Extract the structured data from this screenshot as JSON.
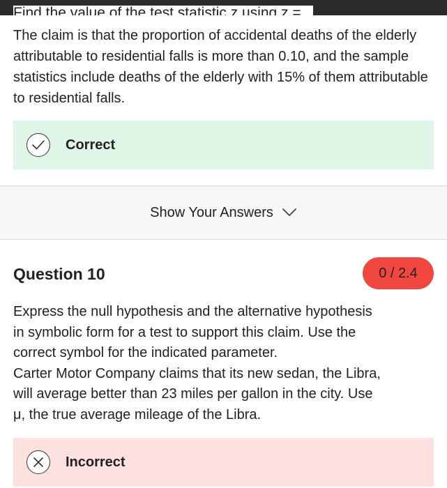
{
  "previous_question": {
    "clipped_line": "Find the value of the test statistic z using z = .",
    "claim_text": "The claim is that the proportion of accidental deaths of the elderly attributable to residential falls is more than 0.10, and the sample statistics include  deaths of the elderly with 15% of them attributable to residential falls.",
    "result": {
      "label": "Correct",
      "icon": "check-icon",
      "color": "#dff5e6"
    }
  },
  "answers_toggle": {
    "label": "Show Your Answers",
    "icon": "chevron-down-icon"
  },
  "question": {
    "title": "Question 10",
    "score": "0 / 2.4",
    "score_color": "#f2473f",
    "text_lines": [
      "Express the null hypothesis and the alternative hypothesis",
      "in symbolic form for a test to support this claim. Use the",
      "correct symbol  for the indicated parameter.",
      "Carter Motor Company claims that its new sedan, the Libra,",
      "will average better than 23 miles per gallon in the city. Use",
      "μ, the true average mileage of the Libra."
    ],
    "result": {
      "label": "Incorrect",
      "icon": "x-icon",
      "color": "#fde0e0"
    }
  }
}
